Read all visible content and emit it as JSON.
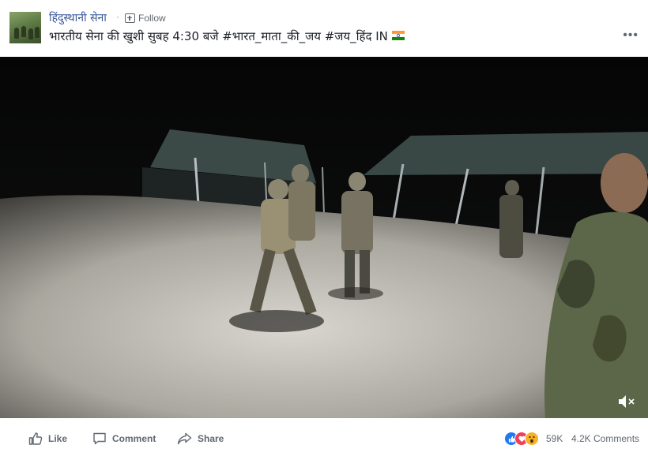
{
  "post": {
    "page_name": "हिंदुस्थानी सेना",
    "separator": "·",
    "follow_label": "Follow",
    "caption": "भारतीय सेना की खुशी सुबह 4:30 बजे #भारत_माता_की_जय #जय_हिंद IN",
    "more_label": "•••"
  },
  "video": {
    "volume_icon": "speaker-muted-icon"
  },
  "actions": {
    "like_label": "Like",
    "comment_label": "Comment",
    "share_label": "Share"
  },
  "stats": {
    "reactions": [
      "like",
      "love",
      "wow"
    ],
    "reaction_count": "59K",
    "comments_count": "4.2K Comments"
  },
  "colors": {
    "link": "#385898",
    "text": "#1d2129",
    "secondary": "#606770",
    "like": "#2078f4",
    "love": "#f33e58",
    "wow": "#f7b125"
  }
}
